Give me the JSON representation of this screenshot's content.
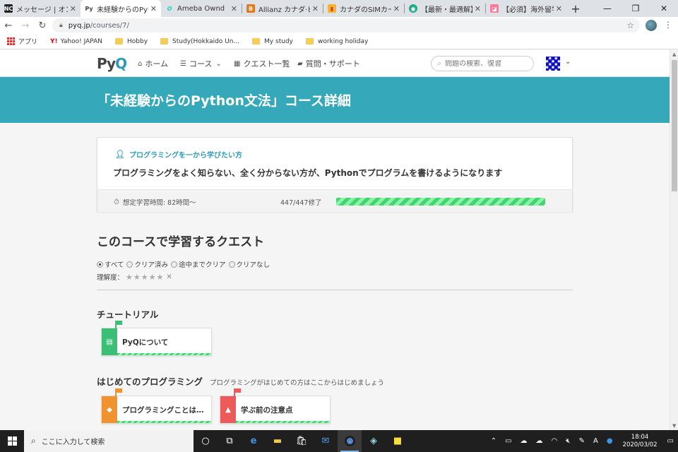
{
  "browser": {
    "tabs": [
      {
        "title": "メッセージ | オンライン",
        "icon": "nc-icon",
        "color": "#333"
      },
      {
        "title": "未経験からのPython",
        "icon": "pyq-icon",
        "color": "#fff",
        "active": true
      },
      {
        "title": "Ameba Ownd",
        "icon": "ameba-icon",
        "color": "#3cb"
      },
      {
        "title": "Allianz カナダ·ビジ",
        "icon": "b-icon",
        "color": "#e77817"
      },
      {
        "title": "カナダのSIMカードな",
        "icon": "bookmark-icon",
        "color": "#d33"
      },
      {
        "title": "【最新・最適解】カナ",
        "icon": "globe-icon",
        "color": "#2a8"
      },
      {
        "title": "【必須】海外留学や",
        "icon": "photo-icon",
        "color": "#f79"
      }
    ],
    "new_tab": "+",
    "url_host": "pyq.jp",
    "url_path": "/courses/7/",
    "bookmarks": [
      {
        "label": "アプリ",
        "type": "apps"
      },
      {
        "label": "Yahoo! JAPAN",
        "type": "yahoo"
      },
      {
        "label": "Hobby",
        "type": "folder"
      },
      {
        "label": "Study(Hokkaido Un...",
        "type": "folder"
      },
      {
        "label": "My study",
        "type": "folder"
      },
      {
        "label": "working holiday",
        "type": "folder"
      }
    ]
  },
  "header": {
    "logo_main": "Py",
    "logo_accent": "Q",
    "nav": [
      {
        "label": "ホーム",
        "icon": "home-icon"
      },
      {
        "label": "コース",
        "icon": "list-icon"
      },
      {
        "label": "クエスト一覧",
        "icon": "grid-icon"
      },
      {
        "label": "質問・サポート",
        "icon": "chat-icon"
      }
    ],
    "search_placeholder": "問題の検索、復習"
  },
  "hero": {
    "title": "「未経験からのPython文法」コース詳細"
  },
  "course": {
    "audience": "プログラミングを一から学びたい方",
    "description": "プログラミングをよく知らない、全く分からない方が、Pythonでプログラムを書けるようになります",
    "study_time": "想定学習時間: 82時間〜",
    "progress_text": "447/447修了",
    "progress": 1.0
  },
  "quests_section": {
    "title": "このコースで学習するクエスト",
    "filters": [
      {
        "label": "すべて",
        "checked": true
      },
      {
        "label": "クリア済み",
        "checked": false
      },
      {
        "label": "途中までクリア",
        "checked": false
      },
      {
        "label": "クリアなし",
        "checked": false
      }
    ],
    "rating_label": "理解度：",
    "rating_stars": "★★★★★",
    "rating_clear": "✕"
  },
  "categories": [
    {
      "title": "チュートリアル",
      "subtitle": "",
      "quests": [
        {
          "title": "PyQについて",
          "color": "#3bbf77",
          "flag": "#3bbf77",
          "icon": "id-card-icon",
          "glyph": "▤"
        }
      ]
    },
    {
      "title": "はじめてのプログラミング",
      "subtitle": "プログラミングがはじめての方はここからはじめましょう",
      "quests": [
        {
          "title": "プログラミングことはじめ",
          "color": "#f0922e",
          "flag": "#f0922e",
          "icon": "graduation-cap-icon",
          "glyph": "◆"
        },
        {
          "title": "学ぶ前の注意点",
          "color": "#ec5a5a",
          "flag": "#ec5a5a",
          "icon": "warning-icon",
          "glyph": "▲"
        }
      ]
    }
  ],
  "taskbar": {
    "search_placeholder": "ここに入力して検索",
    "time": "18:04",
    "date": "2020/03/02",
    "ime": "A"
  }
}
